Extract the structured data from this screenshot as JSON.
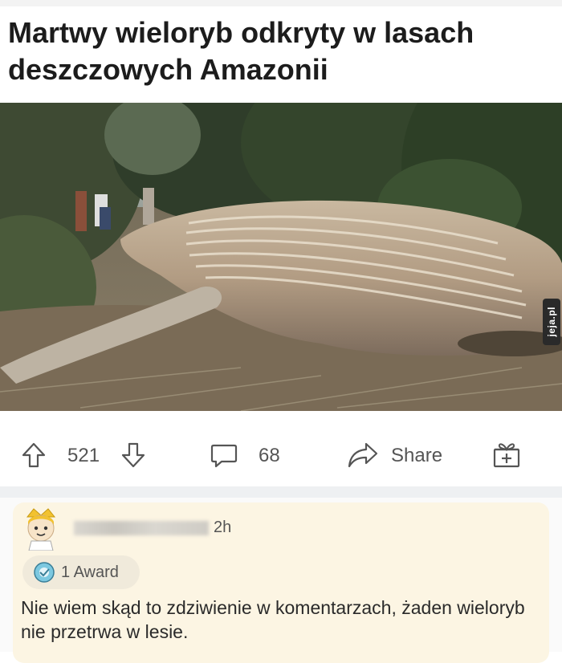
{
  "post": {
    "title": "Martwy wieloryb odkryty w lasach deszczowych Amazonii",
    "image_watermark": "jeja.pl"
  },
  "actions": {
    "upvotes": "521",
    "comments": "68",
    "share_label": "Share"
  },
  "comment": {
    "username": "...",
    "time": "2h",
    "award_label": "1 Award",
    "text": "Nie wiem skąd to zdziwienie w komentarzach, żaden wieloryb nie przetrwa w lesie."
  },
  "icons": [
    "upvote-icon",
    "downvote-icon",
    "comment-icon",
    "share-icon",
    "gift-award-icon",
    "award-icon"
  ],
  "colors": {
    "background": "#ffffff",
    "comment_card": "#fcf5e3",
    "award_pill": "#f0eadb",
    "divider": "#eef0f2"
  }
}
